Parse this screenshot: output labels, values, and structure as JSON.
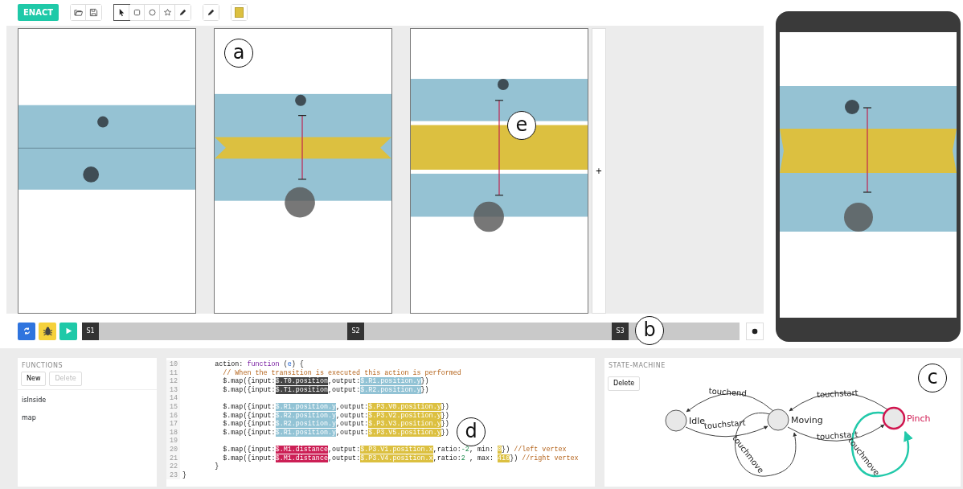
{
  "toolbar": {
    "logo": "ENACT",
    "tools": [
      {
        "kind": "pointer",
        "selected": true
      },
      {
        "kind": "rectangle",
        "selected": false
      },
      {
        "kind": "ellipse",
        "selected": false
      },
      {
        "kind": "star",
        "selected": false
      },
      {
        "kind": "pen",
        "selected": false
      }
    ]
  },
  "stage": {
    "add_label": "+"
  },
  "timeline": {
    "scenes": [
      {
        "label": "S1"
      },
      {
        "label": "S2"
      },
      {
        "label": "S3"
      }
    ]
  },
  "functions": {
    "title": "FUNCTIONS",
    "buttons": [
      {
        "label": "New",
        "disabled": false
      },
      {
        "label": "Delete",
        "disabled": true
      }
    ],
    "items": [
      {
        "label": "isInside",
        "selected": false
      },
      {
        "label": "map",
        "selected": false
      }
    ]
  },
  "code": {
    "lines": [
      {
        "number": "10",
        "tokens": [
          {
            "kind": "plain",
            "text": "        action: "
          },
          {
            "kind": "keyword",
            "text": "function"
          },
          {
            "kind": "plain",
            "text": " ("
          },
          {
            "kind": "param",
            "text": "e"
          },
          {
            "kind": "plain",
            "text": ") {"
          }
        ]
      },
      {
        "number": "11",
        "tokens": [
          {
            "kind": "comment",
            "text": "          // When the transition is executed this action is performed"
          }
        ]
      },
      {
        "number": "12",
        "tokens": [
          {
            "kind": "plain",
            "text": "          $.map({input:"
          },
          {
            "kind": "dark",
            "text": "$.T0.position"
          },
          {
            "kind": "plain",
            "text": ",output:"
          },
          {
            "kind": "blue",
            "text": "$.R1.position.y"
          },
          {
            "kind": "plain",
            "text": "})"
          }
        ]
      },
      {
        "number": "13",
        "tokens": [
          {
            "kind": "plain",
            "text": "          $.map({input:"
          },
          {
            "kind": "dark",
            "text": "$.T1.position"
          },
          {
            "kind": "plain",
            "text": ",output:"
          },
          {
            "kind": "blue",
            "text": "$.R2.position.y"
          },
          {
            "kind": "plain",
            "text": "})"
          }
        ]
      },
      {
        "number": "14"
      },
      {
        "number": "15",
        "tokens": [
          {
            "kind": "plain",
            "text": "          $.map({input:"
          },
          {
            "kind": "blue",
            "text": "$.R1.position.y"
          },
          {
            "kind": "plain",
            "text": ",output:"
          },
          {
            "kind": "yellow",
            "text": "$.P3.V0.position.y"
          },
          {
            "kind": "plain",
            "text": "})"
          }
        ]
      },
      {
        "number": "16",
        "tokens": [
          {
            "kind": "plain",
            "text": "          $.map({input:"
          },
          {
            "kind": "blue",
            "text": "$.R2.position.y"
          },
          {
            "kind": "plain",
            "text": ",output:"
          },
          {
            "kind": "yellow",
            "text": "$.P3.V2.position.y"
          },
          {
            "kind": "plain",
            "text": "})"
          }
        ]
      },
      {
        "number": "17",
        "tokens": [
          {
            "kind": "plain",
            "text": "          $.map({input:"
          },
          {
            "kind": "blue",
            "text": "$.R2.position.y"
          },
          {
            "kind": "plain",
            "text": ",output:"
          },
          {
            "kind": "yellow",
            "text": "$.P3.V3.position.y"
          },
          {
            "kind": "plain",
            "text": "})"
          }
        ]
      },
      {
        "number": "18",
        "tokens": [
          {
            "kind": "plain",
            "text": "          $.map({input:"
          },
          {
            "kind": "blue",
            "text": "$.R1.position.y"
          },
          {
            "kind": "plain",
            "text": ",output:"
          },
          {
            "kind": "yellow",
            "text": "$.P3.V5.position.y"
          },
          {
            "kind": "plain",
            "text": "})"
          }
        ]
      },
      {
        "number": "19"
      },
      {
        "number": "20",
        "tokens": [
          {
            "kind": "plain",
            "text": "          $.map({input:"
          },
          {
            "kind": "red",
            "text": "$.M1.distance"
          },
          {
            "kind": "plain",
            "text": ",output:"
          },
          {
            "kind": "yellow",
            "text": "$.P3.V1.position.x"
          },
          {
            "kind": "plain",
            "text": ",ratio:"
          },
          {
            "kind": "number",
            "text": "-2"
          },
          {
            "kind": "plain",
            "text": ", min: "
          },
          {
            "kind": "yellow",
            "text": "0"
          },
          {
            "kind": "plain",
            "text": "}) "
          },
          {
            "kind": "comment",
            "text": "//left vertex"
          }
        ]
      },
      {
        "number": "21",
        "tokens": [
          {
            "kind": "plain",
            "text": "          $.map({input:"
          },
          {
            "kind": "red",
            "text": "$.M1.distance"
          },
          {
            "kind": "plain",
            "text": ",output:"
          },
          {
            "kind": "yellow",
            "text": "$.P3.V4.position.x"
          },
          {
            "kind": "plain",
            "text": ",ratio:"
          },
          {
            "kind": "number",
            "text": "2"
          },
          {
            "kind": "plain",
            "text": " , max: "
          },
          {
            "kind": "yellow",
            "text": "410"
          },
          {
            "kind": "plain",
            "text": "}) "
          },
          {
            "kind": "comment",
            "text": "//right vertex"
          }
        ]
      },
      {
        "number": "22",
        "tokens": [
          {
            "kind": "plain",
            "text": "        }"
          }
        ]
      },
      {
        "number": "23",
        "tokens": [
          {
            "kind": "plain",
            "text": "}"
          }
        ]
      }
    ]
  },
  "state_machine": {
    "title": "STATE-MACHINE",
    "delete_label": "Delete",
    "states": [
      {
        "label": "Idle",
        "selected": false
      },
      {
        "label": "Moving",
        "selected": false
      },
      {
        "label": "Pinch",
        "selected": true
      }
    ],
    "transitions": [
      {
        "label": "touchend",
        "selected": false
      },
      {
        "label": "touchstart",
        "selected": false
      },
      {
        "label": "touchstart",
        "selected": false
      },
      {
        "label": "touchstart",
        "selected": false
      },
      {
        "label": "touchmove",
        "selected": false
      },
      {
        "label": "touchmove",
        "selected": true
      }
    ]
  },
  "callouts": [
    "a",
    "e",
    "b",
    "c",
    "d"
  ]
}
